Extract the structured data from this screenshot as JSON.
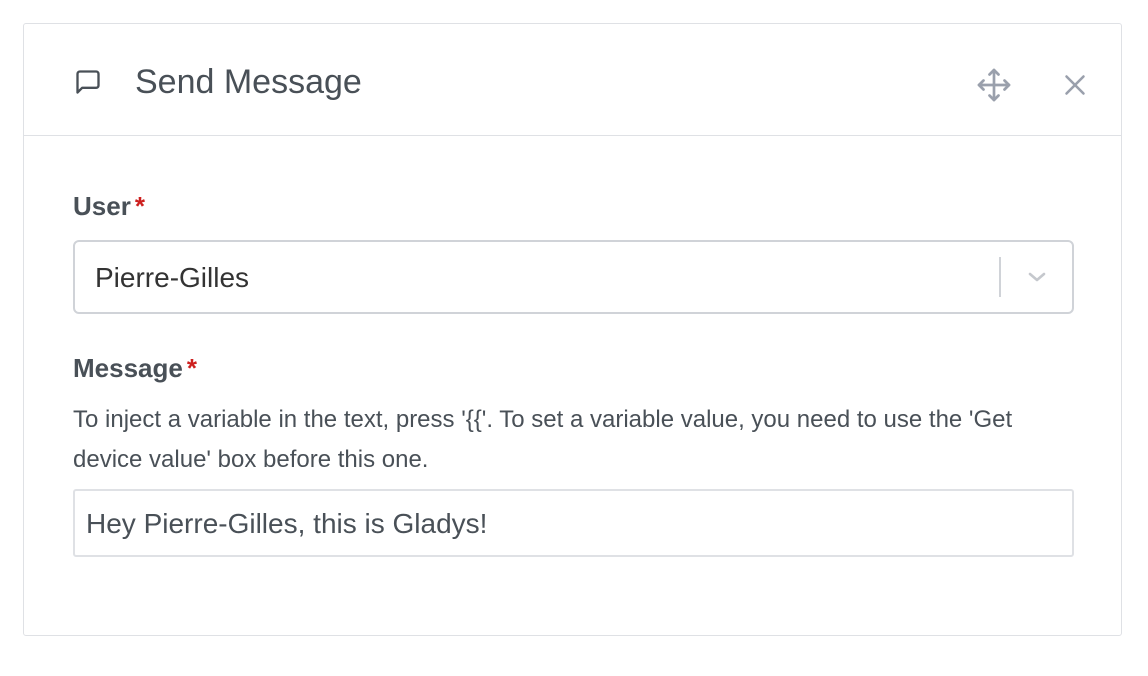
{
  "header": {
    "icon": "message-square-icon",
    "title": "Send Message",
    "move_icon": "move-icon",
    "close_icon": "close-icon"
  },
  "form": {
    "user": {
      "label": "User",
      "required_mark": "*",
      "selected_value": "Pierre-Gilles",
      "dropdown_icon": "chevron-down-icon"
    },
    "message": {
      "label": "Message",
      "required_mark": "*",
      "help_text": "To inject a variable in the text, press '{{'. To set a variable value, you need to use the 'Get device value' box before this one.",
      "value": "Hey Pierre-Gilles, this is Gladys!"
    }
  },
  "colors": {
    "required": "#cd201f",
    "text": "#495057",
    "border": "#dfe1e5",
    "icon_muted": "#9aa0ac"
  }
}
